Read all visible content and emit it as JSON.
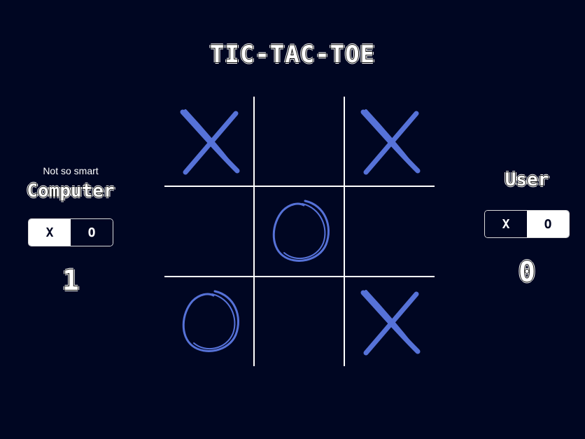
{
  "title": "TIC-TAC-TOE",
  "computer": {
    "subtitle": "Not so smart",
    "name": "Computer",
    "options": [
      "X",
      "O"
    ],
    "selected": "X",
    "score": "1"
  },
  "user": {
    "name": "User",
    "options": [
      "X",
      "O"
    ],
    "selected": "O",
    "score": "0"
  },
  "board": {
    "cells": [
      "X",
      "",
      "X",
      "",
      "O",
      "",
      "O",
      "",
      "X"
    ],
    "mark_color": "#5672d8",
    "line_color": "#ffffff",
    "background": "#000622"
  }
}
